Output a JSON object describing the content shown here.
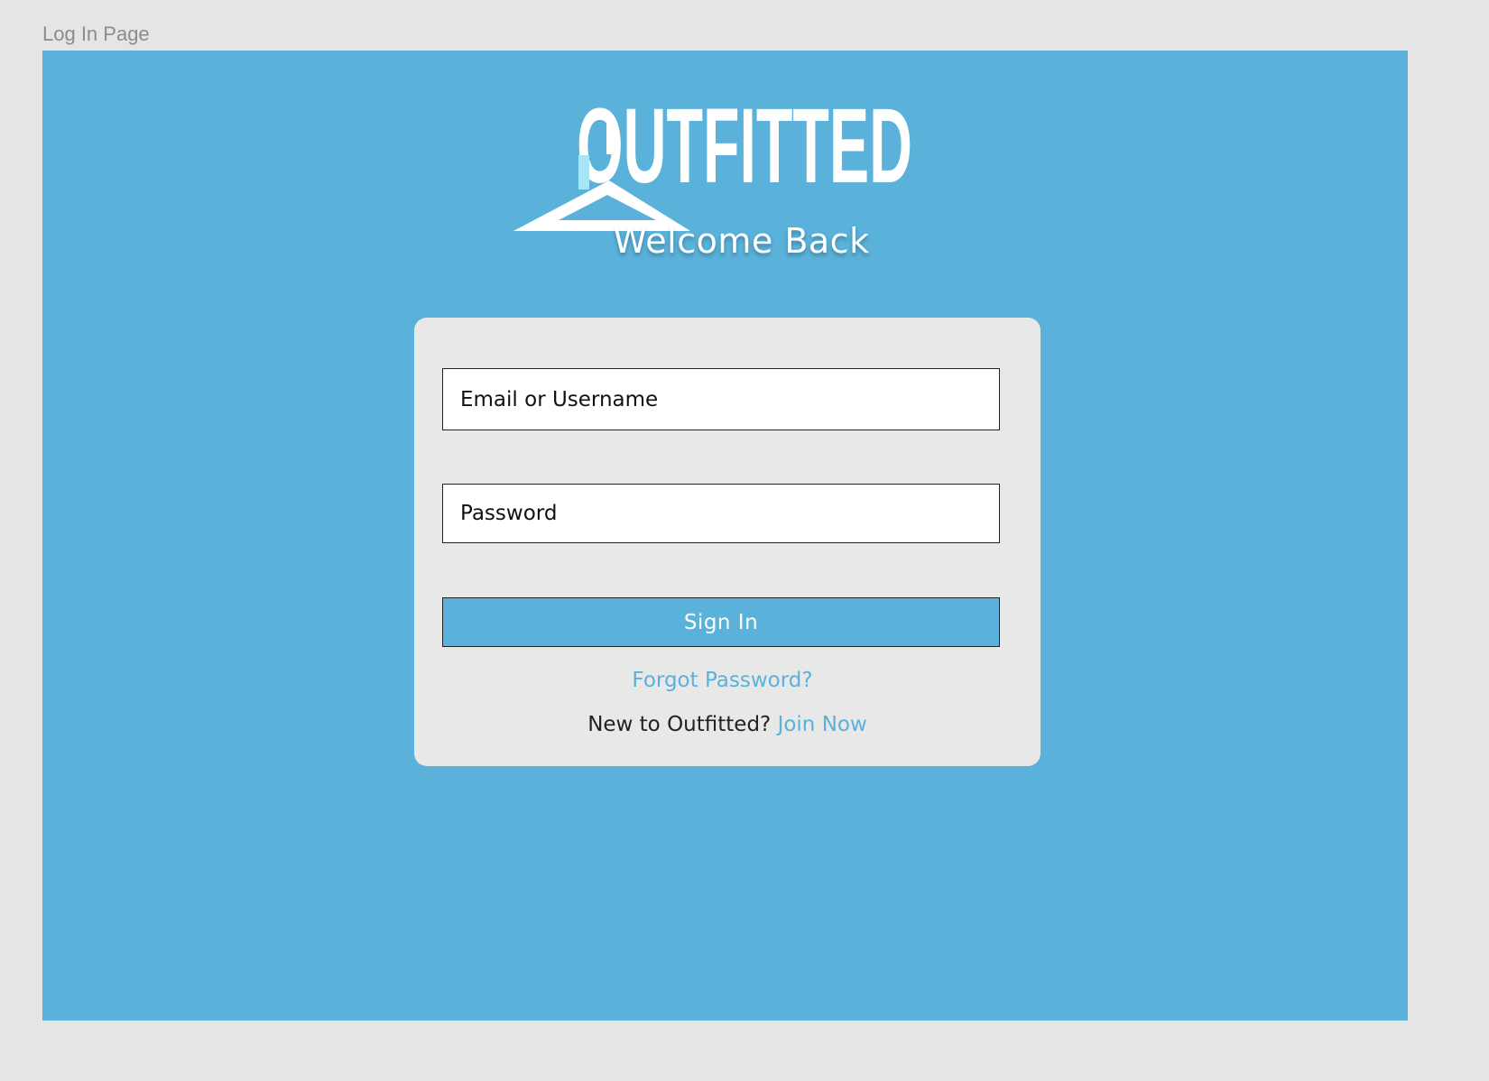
{
  "frame": {
    "label": "Log In Page"
  },
  "brand": {
    "logo_text": "OUTFITTED",
    "accent_color": "#5ab1da",
    "logo_highlight_color": "#a6e6f7"
  },
  "header": {
    "welcome": "Welcome Back"
  },
  "form": {
    "email_placeholder": "Email or Username",
    "password_placeholder": "Password",
    "signin_label": "Sign In",
    "forgot_label": "Forgot Password?",
    "new_prompt": "New to Outfitted?",
    "join_label": "Join Now"
  }
}
